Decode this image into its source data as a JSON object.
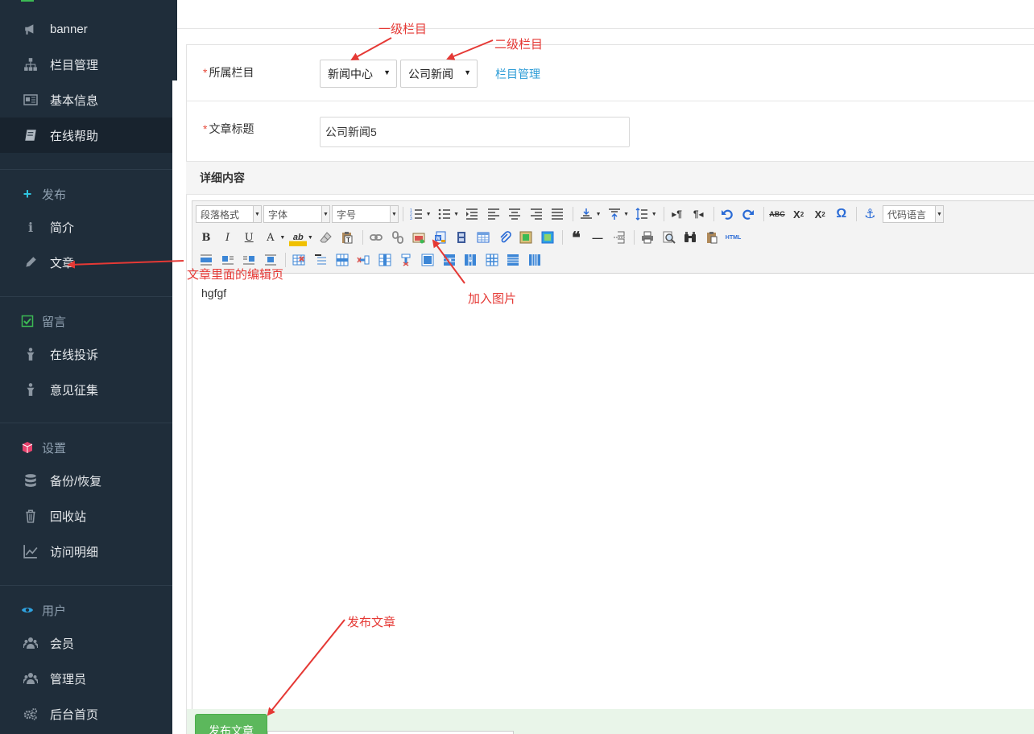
{
  "sidebar": {
    "items": [
      {
        "label": "banner",
        "icon": "megaphone-icon"
      },
      {
        "label": "栏目管理",
        "icon": "sitemap-icon"
      },
      {
        "label": "基本信息",
        "icon": "id-card-icon"
      },
      {
        "label": "在线帮助",
        "icon": "book-icon"
      }
    ],
    "sections": [
      {
        "title": "发布",
        "icon": "plus-icon",
        "color": "#2fc4e0",
        "items": [
          {
            "label": "简介",
            "icon": "info-icon"
          },
          {
            "label": "文章",
            "icon": "pencil-icon"
          }
        ]
      },
      {
        "title": "留言",
        "icon": "check-square-icon",
        "color": "#3cba54",
        "items": [
          {
            "label": "在线投诉",
            "icon": "person-icon"
          },
          {
            "label": "意见征集",
            "icon": "person-icon"
          }
        ]
      },
      {
        "title": "设置",
        "icon": "cube-icon",
        "color": "#e8436e",
        "items": [
          {
            "label": "备份/恢复",
            "icon": "database-icon"
          },
          {
            "label": "回收站",
            "icon": "trash-icon"
          },
          {
            "label": "访问明细",
            "icon": "line-chart-icon"
          }
        ]
      },
      {
        "title": "用户",
        "icon": "eye-icon",
        "color": "#2fa3e0",
        "items": [
          {
            "label": "会员",
            "icon": "users-icon"
          },
          {
            "label": "管理员",
            "icon": "users-icon"
          },
          {
            "label": "后台首页",
            "icon": "gears-icon"
          }
        ]
      }
    ]
  },
  "form": {
    "category_label": "所属栏目",
    "required_mark": "*",
    "category_level1": "新闻中心",
    "category_level2": "公司新闻",
    "category_manage_link": "栏目管理",
    "title_label": "文章标题",
    "title_value": "公司新闻5",
    "detail_header": "详细内容"
  },
  "editor": {
    "paragraph_format": "段落格式",
    "font_family": "字体",
    "font_size": "字号",
    "code_language": "代码语言",
    "html_button": "HTML",
    "content": "hgfgf"
  },
  "actions": {
    "publish": "发布文章"
  },
  "annotations": {
    "level1": "一级栏目",
    "level2": "二级栏目",
    "edit_page": "文章里面的编辑页",
    "add_image": "加入图片",
    "publish_article": "发布文章"
  },
  "colors": {
    "sidebar_bg": "#1f2d3a",
    "accent_link": "#2a9bd6",
    "publish_green": "#5cb85c",
    "annotation_red": "#e53935"
  }
}
